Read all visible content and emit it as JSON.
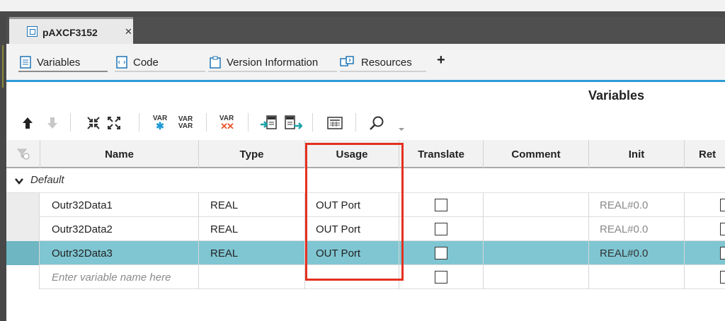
{
  "document_tab": {
    "title": "pAXCF3152",
    "close": "✕"
  },
  "subtabs": [
    {
      "label": "Variables"
    },
    {
      "label": "Code"
    },
    {
      "label": "Version Information"
    },
    {
      "label": "Resources"
    }
  ],
  "add_tab": "+",
  "panel_title": "Variables",
  "toolbar": {
    "var_add_label": "VAR",
    "var_add2_label": "VAR",
    "var_add2_sub": "VAR",
    "var_delete_label": "VAR"
  },
  "columns": [
    "Name",
    "Type",
    "Usage",
    "Translate",
    "Comment",
    "Init",
    "Ret"
  ],
  "group": {
    "label": "Default"
  },
  "rows": [
    {
      "name": "Outr32Data1",
      "type": "REAL",
      "usage": "OUT Port",
      "translate": false,
      "comment": "",
      "init": "REAL#0.0",
      "selected": false
    },
    {
      "name": "Outr32Data2",
      "type": "REAL",
      "usage": "OUT Port",
      "translate": false,
      "comment": "",
      "init": "REAL#0.0",
      "selected": false
    },
    {
      "name": "Outr32Data3",
      "type": "REAL",
      "usage": "OUT Port",
      "translate": false,
      "comment": "",
      "init": "REAL#0.0",
      "selected": true
    }
  ],
  "new_row": {
    "placeholder": "Enter variable name here"
  },
  "colors": {
    "accent_blue": "#2e9bd6",
    "selection": "#7fc6d2",
    "highlight_box": "#e53020"
  }
}
